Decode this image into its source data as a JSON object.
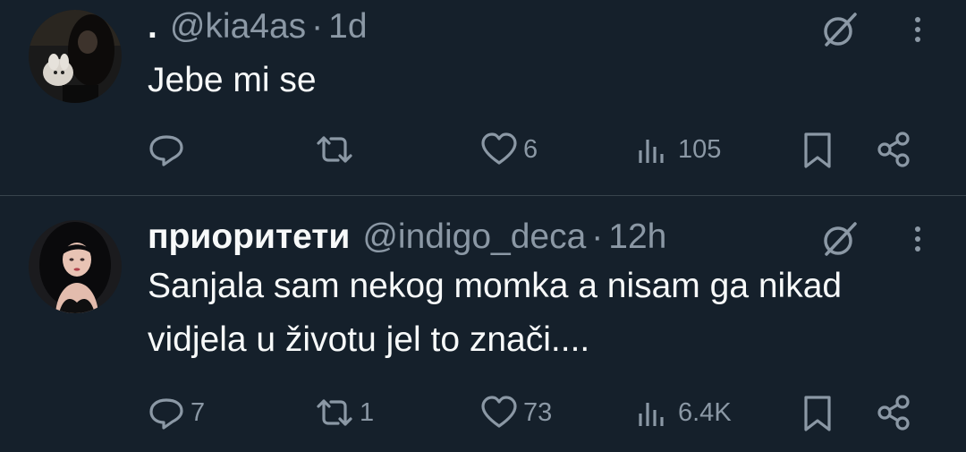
{
  "tweets": [
    {
      "display_name": ".",
      "handle": "@kia4as",
      "separator": "·",
      "time": "1d",
      "text": "Jebe mi se",
      "counts": {
        "replies": "",
        "reposts": "",
        "likes": "6",
        "views": "105"
      }
    },
    {
      "display_name": "приоритети",
      "handle": "@indigo_deca",
      "separator": "·",
      "time": "12h",
      "text": "Sanjala sam nekog momka a nisam ga nikad vidjela u životu jel to znači....",
      "counts": {
        "replies": "7",
        "reposts": "1",
        "likes": "73",
        "views": "6.4K"
      }
    }
  ],
  "colors": {
    "background": "#15202b",
    "text": "#f7f9f9",
    "muted": "#8b98a5",
    "divider": "#38444d"
  },
  "icons": [
    "grok-icon",
    "more-icon",
    "reply-icon",
    "repost-icon",
    "like-icon",
    "views-icon",
    "bookmark-icon",
    "share-icon"
  ]
}
